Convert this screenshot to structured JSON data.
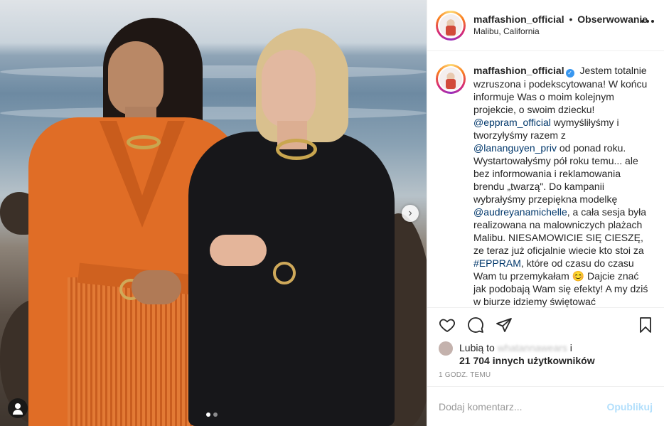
{
  "post": {
    "username": "maffashion_official",
    "bullet": "•",
    "follow_label": "Obserwowanie",
    "location": "Malibu, California",
    "caption": {
      "intro": "Jestem totalnie wzruszona i podekscytowana! W końcu informuje Was o moim kolejnym projekcie, o swoim dziecku!",
      "mention1": "@eppram_official",
      "part2": " wymyśliłyśmy i tworzyłyśmy razem z ",
      "mention2": "@lananguyen_priv",
      "part3": " od ponad roku. Wystartowałyśmy pół roku temu... ale bez informowania i reklamowania brendu „twarzą\". Do kampanii wybrałyśmy przepiękna modelkę ",
      "mention3": "@audreyanamichelle",
      "part4": ", a cała sesja była realizowana na malowniczych plażach Malibu. NIESAMOWICIE SIĘ CIESZĘ, ze teraz już oficjalnie wiecie kto stoi za ",
      "hashtag": "#EPPRAM",
      "part5": ", które od czasu do czasu Wam tu przemykałam 😊 Dajcie znać jak podobają Wam się efekty! A my dziś w biurze idziemy świętować"
    },
    "likes": {
      "prefix": "Lubią to",
      "blurred_user": "whatannawears",
      "conjunction": "i",
      "count_text": "21 704 innych użytkowników"
    },
    "time": "1 GODZ. TEMU",
    "comment_placeholder": "Dodaj komentarz...",
    "publish_label": "Opublikuj"
  },
  "carousel": {
    "slides": 2,
    "active_index": 0
  },
  "icons": {
    "more": "more-options-icon",
    "like": "heart-icon",
    "comment": "comment-icon",
    "share": "share-icon",
    "save": "bookmark-icon",
    "next": "chevron-right-icon",
    "tag": "user-tag-icon"
  },
  "colors": {
    "link": "#00376b",
    "verified": "#3897f0",
    "publish_disabled": "#b2dffc"
  }
}
